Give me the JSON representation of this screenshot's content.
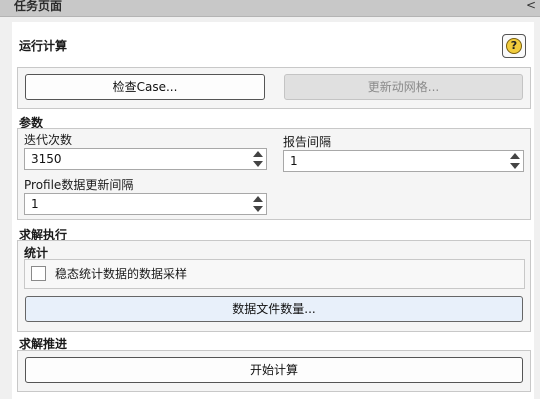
{
  "titlebar": {
    "title": "任务页面",
    "collapse_glyph": "<"
  },
  "run_calculation": {
    "heading": "运行计算",
    "help_glyph": "?",
    "check_case_label": "检查Case...",
    "update_mesh_label": "更新动网格..."
  },
  "parameters": {
    "heading": "参数",
    "iterations_label": "迭代次数",
    "iterations_value": "3150",
    "report_interval_label": "报告间隔",
    "report_interval_value": "1",
    "profile_interval_label": "Profile数据更新间隔",
    "profile_interval_value": "1"
  },
  "solution_execution": {
    "heading": "求解执行",
    "statistics_heading": "统计",
    "sampling_label": "稳态统计数据的数据采样",
    "data_file_quantities_label": "数据文件数量..."
  },
  "solution_advancement": {
    "heading": "求解推进",
    "start_calculation_label": "开始计算"
  }
}
